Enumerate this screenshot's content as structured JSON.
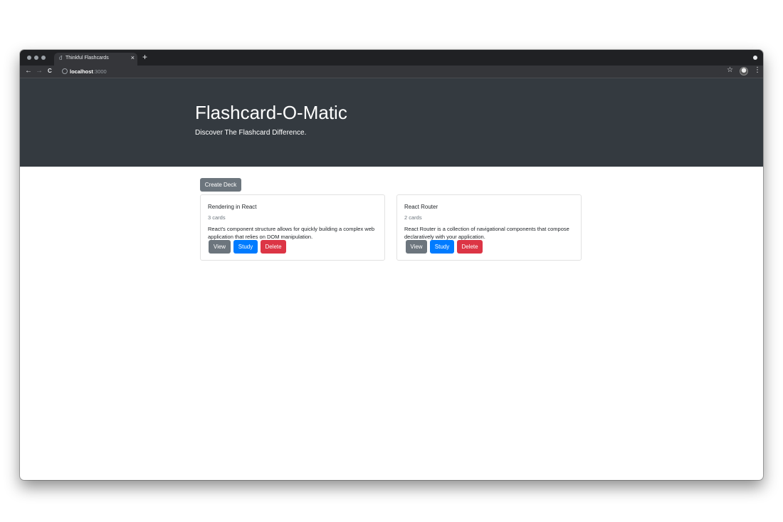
{
  "browser": {
    "tab_title": "Thinkful Flashcards",
    "tab_close": "×",
    "new_tab": "+",
    "url_host": "localhost",
    "url_port": ":3000",
    "back": "←",
    "forward": "→",
    "reload": "C",
    "bookmark": "☆",
    "menu": "⋮"
  },
  "header": {
    "title": "Flashcard-O-Matic",
    "subtitle": "Discover The Flashcard Difference."
  },
  "actions": {
    "create_deck_label": "Create Deck"
  },
  "decks": [
    {
      "name": "Rendering in React",
      "count": "3 cards",
      "description": "React's component structure allows for quickly building a complex web application that relies on DOM manipulation.",
      "view_label": "View",
      "study_label": "Study",
      "delete_label": "Delete"
    },
    {
      "name": "React Router",
      "count": "2 cards",
      "description": "React Router is a collection of navigational components that compose declaratively with your application.",
      "view_label": "View",
      "study_label": "Study",
      "delete_label": "Delete"
    }
  ],
  "colors": {
    "header_bg": "#343a40",
    "secondary": "#6c757d",
    "primary": "#007bff",
    "danger": "#dc3545"
  },
  "icons": {
    "favicon": "document-icon",
    "secure": "info-icon",
    "bookmark": "star-icon",
    "profile": "avatar",
    "menu": "kebab-menu-icon"
  }
}
